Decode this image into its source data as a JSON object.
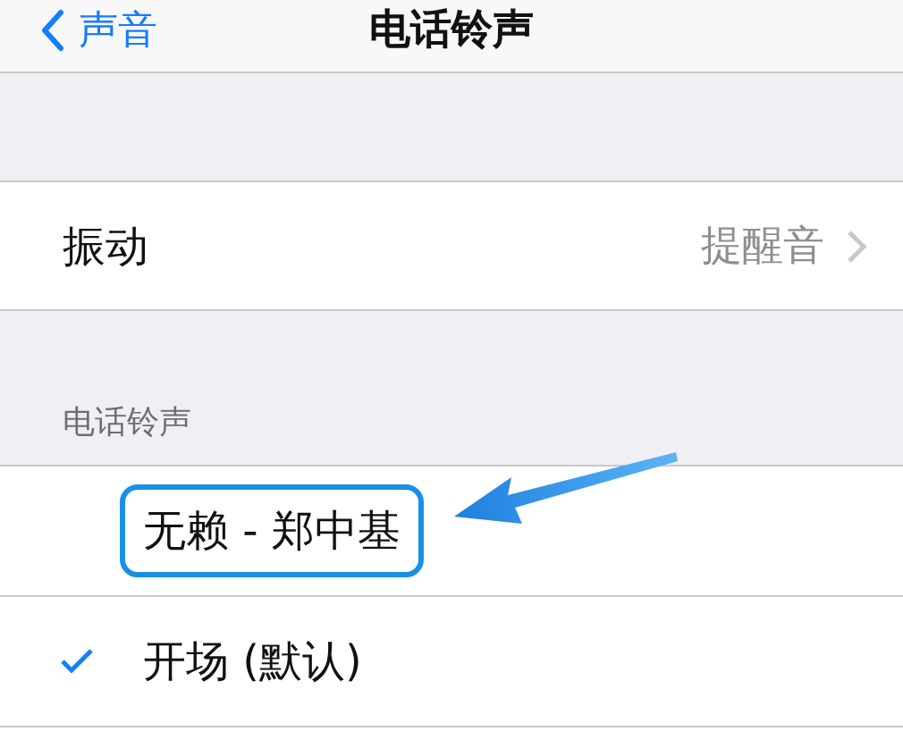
{
  "nav": {
    "back_label": "声音",
    "title": "电话铃声"
  },
  "vibration": {
    "label": "振动",
    "value": "提醒音"
  },
  "section_header": "电话铃声",
  "ringtones": [
    {
      "label": "无赖 - 郑中基",
      "selected": false,
      "highlighted": true
    },
    {
      "label": "开场 (默认)",
      "selected": true,
      "highlighted": false
    }
  ]
}
